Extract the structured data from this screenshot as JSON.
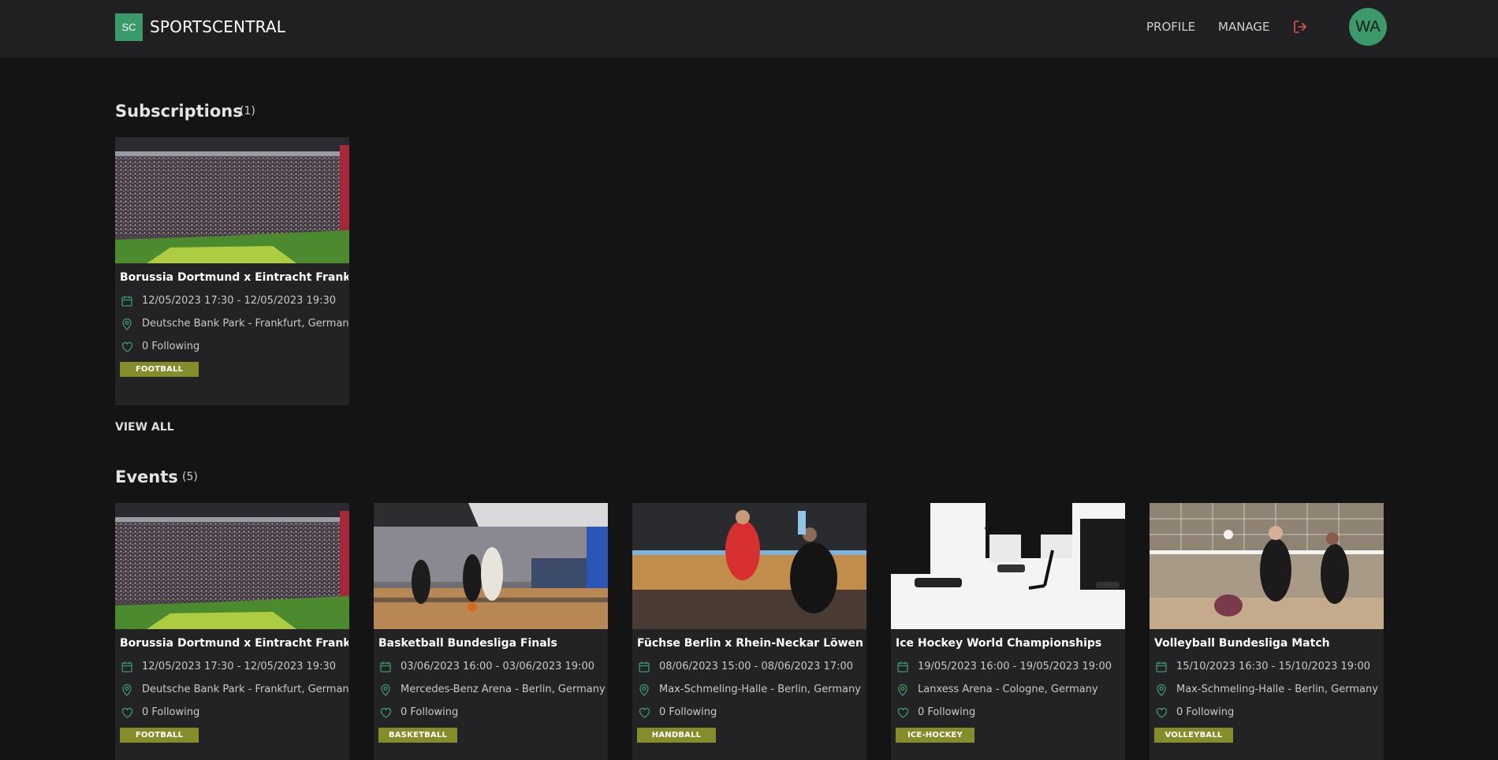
{
  "header": {
    "logo_text": "SC",
    "brand": "SPORTSCENTRAL",
    "nav": {
      "profile": "PROFILE",
      "manage": "MANAGE"
    },
    "logout_icon": "logout-icon",
    "avatar_initials": "WA"
  },
  "colors": {
    "accent": "#3b9a6a",
    "badge": "#858d2b",
    "background": "#141414",
    "card": "#232326",
    "logout": "#e0534f"
  },
  "subscriptions": {
    "title": "Subscriptions",
    "count": "(1)",
    "view_all": "VIEW ALL",
    "cards": [
      {
        "title": "Borussia Dortmund x Eintracht Frankfurt",
        "date": "12/05/2023 17:30 - 12/05/2023 19:30",
        "location": "Deutsche Bank Park - Frankfurt, Germany",
        "following": "0 Following",
        "sport": "FOOTBALL",
        "image": "stadium-crowd-photo"
      }
    ]
  },
  "events": {
    "title": "Events",
    "count": "(5)",
    "cards": [
      {
        "title": "Borussia Dortmund x Eintracht Frankfurt",
        "date": "12/05/2023 17:30 - 12/05/2023 19:30",
        "location": "Deutsche Bank Park - Frankfurt, Germany",
        "following": "0 Following",
        "sport": "FOOTBALL",
        "image": "stadium-crowd-photo"
      },
      {
        "title": "Basketball Bundesliga Finals",
        "date": "03/06/2023 16:00 - 03/06/2023 19:00",
        "location": "Mercedes-Benz Arena - Berlin, Germany",
        "following": "0 Following",
        "sport": "BASKETBALL",
        "image": "basketball-game-photo"
      },
      {
        "title": "Füchse Berlin x Rhein-Neckar Löwen",
        "date": "08/06/2023 15:00 - 08/06/2023 17:00",
        "location": "Max-Schmeling-Halle - Berlin, Germany",
        "following": "0 Following",
        "sport": "HANDBALL",
        "image": "handball-game-photo"
      },
      {
        "title": "Ice Hockey World Championships",
        "date": "19/05/2023 16:00 - 19/05/2023 19:00",
        "location": "Lanxess Arena - Cologne, Germany",
        "following": "0 Following",
        "sport": "ICE-HOCKEY",
        "image": "ice-hockey-photo"
      },
      {
        "title": "Volleyball Bundesliga Match",
        "date": "15/10/2023 16:30 - 15/10/2023 19:00",
        "location": "Max-Schmeling-Halle - Berlin, Germany",
        "following": "0 Following",
        "sport": "VOLLEYBALL",
        "image": "volleyball-game-photo"
      }
    ]
  }
}
